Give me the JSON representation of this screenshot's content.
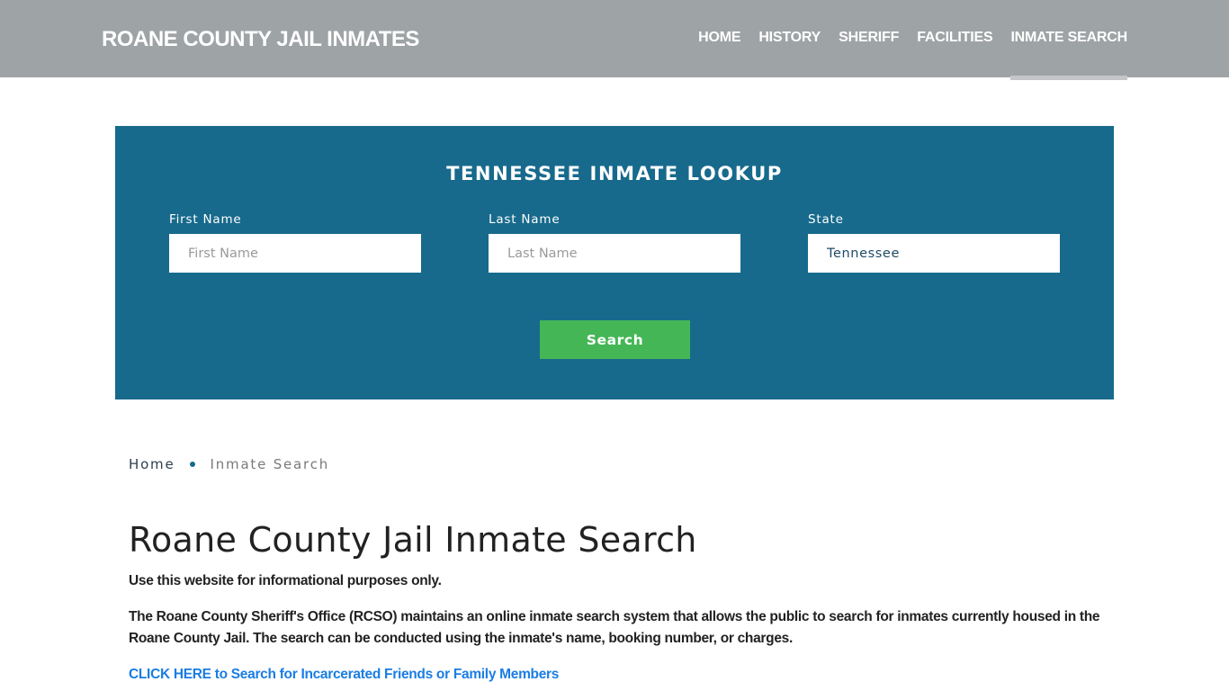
{
  "header": {
    "brand": "ROANE COUNTY JAIL INMATES",
    "nav": [
      {
        "label": "HOME",
        "active": false
      },
      {
        "label": "HISTORY",
        "active": false
      },
      {
        "label": "SHERIFF",
        "active": false
      },
      {
        "label": "FACILITIES",
        "active": false
      },
      {
        "label": "INMATE SEARCH",
        "active": true
      }
    ]
  },
  "lookup": {
    "title": "TENNESSEE INMATE LOOKUP",
    "fields": {
      "first_name": {
        "label": "First Name",
        "placeholder": "First Name",
        "value": ""
      },
      "last_name": {
        "label": "Last Name",
        "placeholder": "Last Name",
        "value": ""
      },
      "state": {
        "label": "State",
        "value": "Tennessee"
      }
    },
    "search_label": "Search"
  },
  "breadcrumb": {
    "home": "Home",
    "current": "Inmate Search"
  },
  "content": {
    "title": "Roane County Jail Inmate Search",
    "intro": "Use this website for informational purposes only.",
    "description": "The Roane County Sheriff's Office (RCSO) maintains an online inmate search system that allows the public to search for inmates currently housed in the Roane County Jail. The search can be conducted using the inmate's name, booking number, or charges.",
    "cta": "CLICK HERE to Search for Incarcerated Friends or Family Members"
  },
  "colors": {
    "header_bg": "#9ea3a6",
    "panel_bg": "#176a8c",
    "button_green": "#45b656",
    "link_blue": "#1a7de3"
  }
}
